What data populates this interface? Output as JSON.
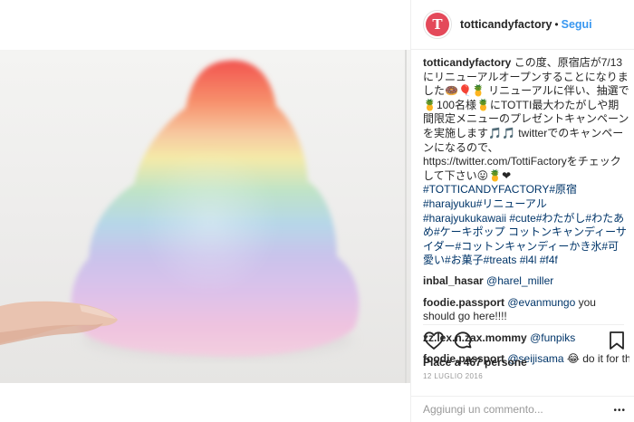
{
  "post": {
    "username": "totticandyfactory",
    "separator": "•",
    "follow_label": "Segui",
    "avatar_letter": "T",
    "caption_text": " この度、原宿店が7/13にリニューアルオープンすることになりました🍩🎈🍍 リニューアルに伴い、抽選で🍍100名様🍍にTOTTI最大わたがしや期間限定メニューのプレゼントキャンペーンを実施します🎵🎵 twitterでのキャンペーンになるので、https://twitter.com/TottiFactoryをチェックして下さい😛🍍❤ ",
    "hashtags": "#TOTTICANDYFACTORY#原宿 #harajyuku#リニューアル #harajyukukawaii #cute#わたがし#わたあめ#ケーキポップ コットンキャンディーサイダー#コットンキャンディーかき氷#可愛い#お菓子#treats #l4l #f4f"
  },
  "comments": [
    {
      "user": "inbal_hasar",
      "text": "@harel_miller",
      "is_link": true
    },
    {
      "user": "foodie.passport",
      "text": "@evanmungo you should go here!!!!",
      "link": "@evanmungo",
      "rest": " you should go here!!!!"
    },
    {
      "user": "zz.lex.n.zax.mommy",
      "text": "@funpiks",
      "is_link": true
    },
    {
      "user": "foodie.passport",
      "text": "@seijisama 😂 do it for the",
      "link": "@seijisama",
      "rest": " 😂 do it for the"
    }
  ],
  "actions": {
    "like_icon": "heart-icon",
    "comment_icon": "comment-icon",
    "save_icon": "bookmark-icon"
  },
  "likes_text": "Piace a 467 persone",
  "date_text": "12 LUGLIO 2016",
  "add_comment": {
    "placeholder": "Aggiungi un commento...",
    "more_icon": "more-options-icon"
  },
  "colors": {
    "link_blue": "#3897f0",
    "mention_blue": "#003569",
    "avatar_red": "#e4495a",
    "text": "#262626",
    "muted": "#999999"
  }
}
